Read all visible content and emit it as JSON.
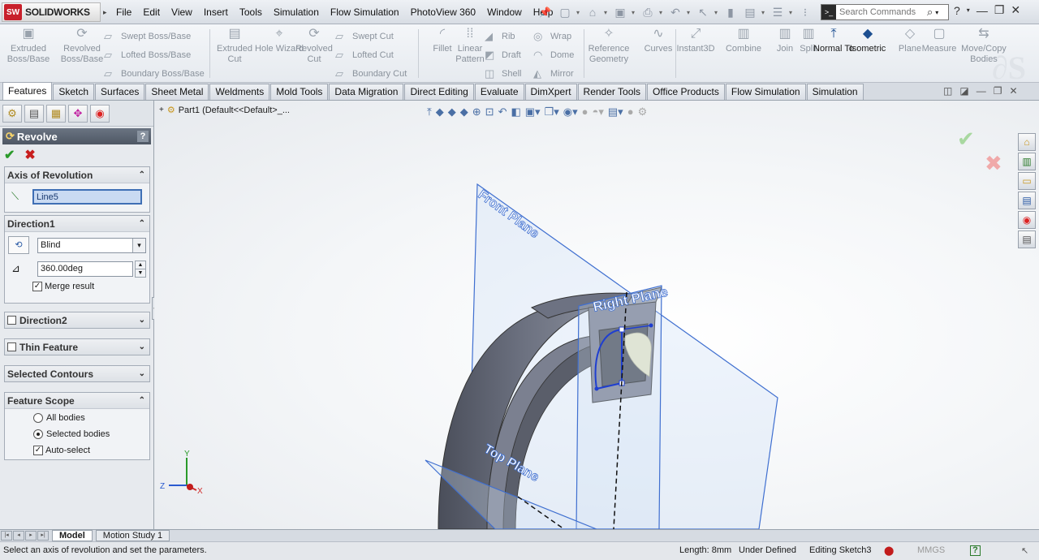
{
  "app": {
    "logo_mark": "SW",
    "logo_text": "SOLIDWORKS",
    "logo_arrow": "▸"
  },
  "menu": [
    "File",
    "Edit",
    "View",
    "Insert",
    "Tools",
    "Simulation",
    "Flow Simulation",
    "PhotoView 360",
    "Window",
    "Help"
  ],
  "search": {
    "placeholder": "Search Commands"
  },
  "ribbon": {
    "large": [
      {
        "label": "Extruded Boss/Base",
        "icon": "extruded-boss-icon",
        "active": false
      },
      {
        "label": "Revolved Boss/Base",
        "icon": "revolved-boss-icon",
        "active": false
      },
      {
        "label": "Extruded Cut",
        "icon": "extruded-cut-icon",
        "active": false
      },
      {
        "label": "Hole Wizard",
        "icon": "hole-wizard-icon",
        "active": false
      },
      {
        "label": "Revolved Cut",
        "icon": "revolved-cut-icon",
        "active": false
      },
      {
        "label": "Fillet",
        "icon": "fillet-icon",
        "active": false
      },
      {
        "label": "Linear Pattern",
        "icon": "linear-pattern-icon",
        "active": false
      },
      {
        "label": "Reference Geometry",
        "icon": "reference-geometry-icon",
        "active": false
      },
      {
        "label": "Curves",
        "icon": "curves-icon",
        "active": false
      },
      {
        "label": "Instant3D",
        "icon": "instant3d-icon",
        "active": false
      },
      {
        "label": "Combine",
        "icon": "combine-icon",
        "active": false
      },
      {
        "label": "Join",
        "icon": "join-icon",
        "active": false
      },
      {
        "label": "Split",
        "icon": "split-icon",
        "active": false
      },
      {
        "label": "Normal To",
        "icon": "normal-to-icon",
        "active": true
      },
      {
        "label": "Isometric",
        "icon": "isometric-icon",
        "active": true
      },
      {
        "label": "Plane",
        "icon": "plane-icon",
        "active": false
      },
      {
        "label": "Measure",
        "icon": "measure-icon",
        "active": false
      },
      {
        "label": "Move/Copy Bodies",
        "icon": "move-copy-icon",
        "active": false
      }
    ],
    "small": [
      {
        "label": "Swept Boss/Base",
        "icon": "swept-boss-icon"
      },
      {
        "label": "Lofted Boss/Base",
        "icon": "lofted-boss-icon"
      },
      {
        "label": "Boundary Boss/Base",
        "icon": "boundary-boss-icon"
      },
      {
        "label": "Swept Cut",
        "icon": "swept-cut-icon"
      },
      {
        "label": "Lofted Cut",
        "icon": "lofted-cut-icon"
      },
      {
        "label": "Boundary Cut",
        "icon": "boundary-cut-icon"
      },
      {
        "label": "Rib",
        "icon": "rib-icon"
      },
      {
        "label": "Draft",
        "icon": "draft-icon"
      },
      {
        "label": "Shell",
        "icon": "shell-icon"
      },
      {
        "label": "Wrap",
        "icon": "wrap-icon"
      },
      {
        "label": "Dome",
        "icon": "dome-icon"
      },
      {
        "label": "Mirror",
        "icon": "mirror-icon"
      }
    ]
  },
  "tabs": [
    "Features",
    "Sketch",
    "Surfaces",
    "Sheet Metal",
    "Weldments",
    "Mold Tools",
    "Data Migration",
    "Direct Editing",
    "Evaluate",
    "DimXpert",
    "Render Tools",
    "Office Products",
    "Flow Simulation",
    "Simulation"
  ],
  "active_tab": "Features",
  "property_manager": {
    "title": "Revolve",
    "help": "?",
    "ok": "✔",
    "cancel": "✖",
    "axis": {
      "header": "Axis of Revolution",
      "value": "Line5"
    },
    "direction1": {
      "header": "Direction1",
      "type": "Blind",
      "angle": "360.00deg",
      "merge_label": "Merge result",
      "merge_checked": true
    },
    "direction2": {
      "header": "Direction2"
    },
    "thin": {
      "header": "Thin Feature"
    },
    "contours": {
      "header": "Selected Contours"
    },
    "scope": {
      "header": "Feature Scope",
      "all_bodies": "All bodies",
      "selected_bodies": "Selected bodies",
      "auto_select": "Auto-select",
      "selected": "Selected bodies",
      "auto_checked": true
    }
  },
  "viewport": {
    "tree_label": "Part1  (Default<<Default>_...",
    "planes": {
      "front": "Front Plane",
      "right": "Right Plane",
      "top": "Top Plane"
    },
    "triad": {
      "x": "X",
      "y": "Y",
      "z": "Z"
    }
  },
  "bottom_tabs": [
    "Model",
    "Motion Study 1"
  ],
  "status": {
    "message": "Select an axis of revolution and set the parameters.",
    "length": "Length: 8mm",
    "defined": "Under Defined",
    "editing": "Editing Sketch3",
    "units": "MMGS",
    "help": "?"
  }
}
